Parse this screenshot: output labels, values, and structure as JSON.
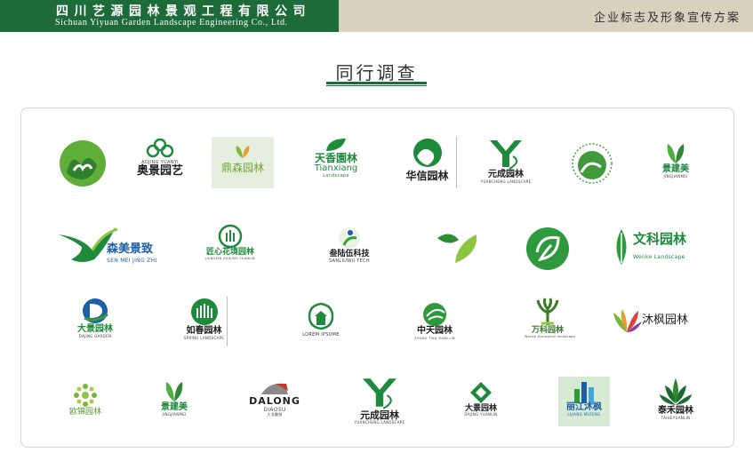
{
  "header": {
    "company_cn": "四川艺源园林景观工程有限公司",
    "company_en": "Sichuan Yiyuan Garden Landscape Engineering Co., Ltd.",
    "doc_title": "企业标志及形象宣传方案"
  },
  "section": {
    "title": "同行调查"
  },
  "colors": {
    "brand_green": "#1e6b3a",
    "header_tan": "#d9d1c0",
    "logo_green": "#1d8a3c"
  },
  "logos": {
    "aojing": {
      "small": "AOJING YUANYI",
      "name": "奥景园艺"
    },
    "dingsen": {
      "name": "鼎森园林"
    },
    "tianxiang": {
      "name": "天香園林",
      "en1": "Tianxiang",
      "en2": "Landscape"
    },
    "huaxin": {
      "name": "华信园林"
    },
    "yuancheng": {
      "name": "元成园林",
      "en": "YUANCHENG LANDSCAPE"
    },
    "jingjianmei": {
      "name": "景建美",
      "en": "JINGJIANMEI"
    },
    "senmei": {
      "name": "森美景致",
      "en": "SEN MEI JING ZHI"
    },
    "jiangxin": {
      "name": "匠心花境园林",
      "en": "JIANGXIN HUAJING YUANLIN"
    },
    "sanluwu": {
      "name": "叁陆伍科技",
      "en": "SANLIUWU TECH"
    },
    "wenke": {
      "name": "文科园林",
      "en": "Wenke Landscape"
    },
    "dajing": {
      "name": "大景园林",
      "en": "DAJING GARDEN"
    },
    "rujing": {
      "name": "如春园林",
      "en": "SPRING LANDSCAPE"
    },
    "lorem": {
      "name": "LOREM IPSUME"
    },
    "zhongtian": {
      "name": "中天园林",
      "en": "ZHONG TIAN YUAN LIN"
    },
    "wanke": {
      "name": "万科园林",
      "en": "Wanke Ecological landscape"
    },
    "mufeng": {
      "name": "沐枫园林"
    },
    "oujin": {
      "name": "欧锦园林"
    },
    "jingjianmei2": {
      "name": "景建美",
      "en": "JINGJIANMEI"
    },
    "dalong": {
      "name": "DALONG",
      "en": "DIAOSU",
      "small": "大龙雕塑"
    },
    "yuancheng2": {
      "name": "元成园林",
      "en": "YUANCHENG LANDSCAPE"
    },
    "dajing2": {
      "name": "大景园林",
      "en": "DAJING YUANLIN"
    },
    "lijiang": {
      "name": "丽江沐枫",
      "en": "LIJIANG MUFENG"
    },
    "taihe": {
      "name": "泰禾园林",
      "en": "TAIHEYUANLIN"
    }
  }
}
